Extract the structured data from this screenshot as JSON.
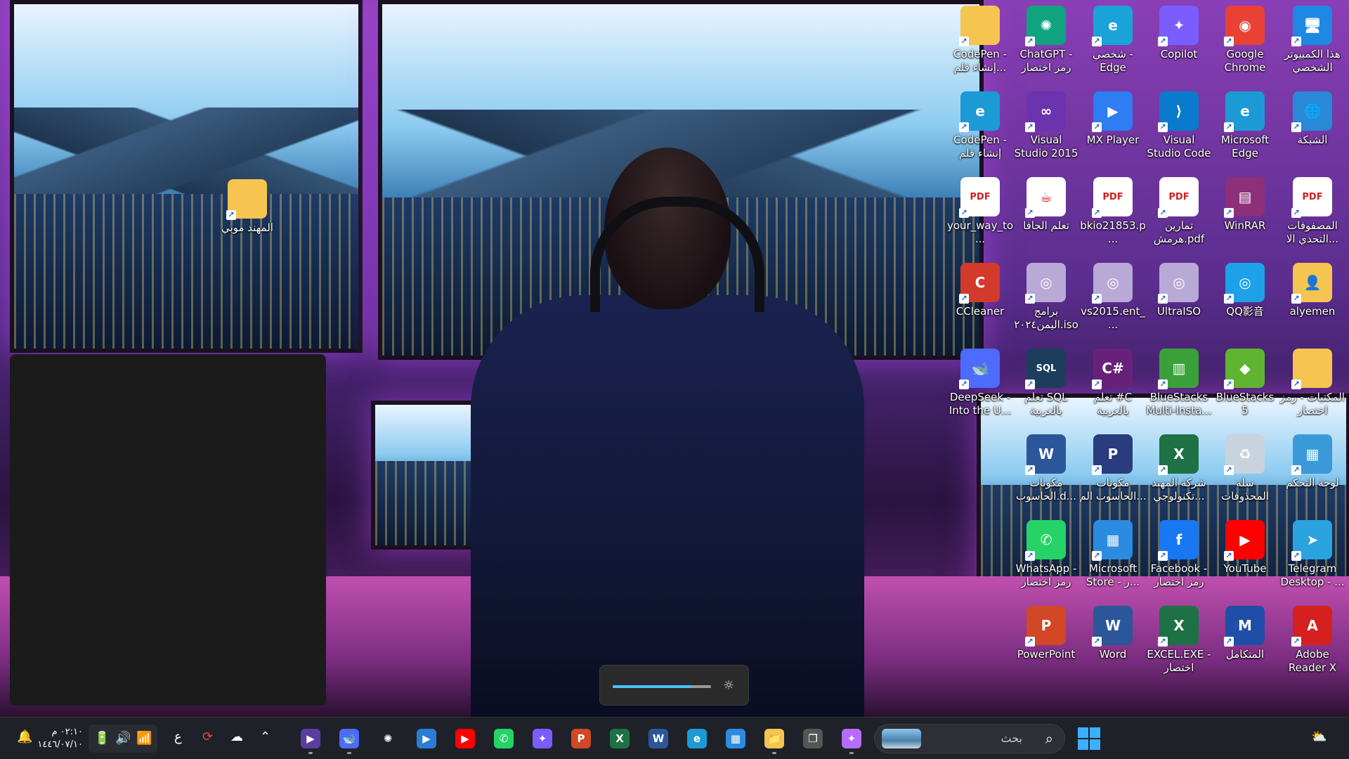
{
  "desktop_icons": [
    {
      "label": "هذا الكمبيوتر الشخصي",
      "icon": "this-pc-icon",
      "color": "#1e88e5",
      "glyph": "🖥"
    },
    {
      "label": "Google Chrome",
      "icon": "chrome-icon",
      "color": "#e94235",
      "glyph": "◉"
    },
    {
      "label": "Copilot",
      "icon": "copilot-icon",
      "color": "#7b5cff",
      "glyph": "✦"
    },
    {
      "label": "شخصي - Edge",
      "icon": "edge-icon",
      "color": "#1aa3d9",
      "glyph": "e"
    },
    {
      "label": "ChatGPT - رمز اختصار",
      "icon": "chatgpt-icon",
      "color": "#10a37f",
      "glyph": "✺"
    },
    {
      "label": "CodePen - إنشاء قلم...",
      "icon": "folder-icon",
      "color": "#f5c451",
      "glyph": ""
    },
    {
      "label": "الشبكة",
      "icon": "network-icon",
      "color": "#2a88d8",
      "glyph": "🌐"
    },
    {
      "label": "Microsoft Edge",
      "icon": "edge-icon",
      "color": "#1c9ad6",
      "glyph": "e"
    },
    {
      "label": "Visual Studio Code",
      "icon": "vscode-icon",
      "color": "#0a7acc",
      "glyph": "⟩"
    },
    {
      "label": "MX Player",
      "icon": "mxplayer-icon",
      "color": "#2f7df3",
      "glyph": "▶"
    },
    {
      "label": "Visual Studio 2015",
      "icon": "visualstudio-icon",
      "color": "#6c33af",
      "glyph": "∞"
    },
    {
      "label": "CodePen - إنشاء قلم",
      "icon": "edge-icon",
      "color": "#1c9ad6",
      "glyph": "e"
    },
    {
      "label": "المصفوفات التحدي الا...",
      "icon": "pdf-icon",
      "color": "#ffffff",
      "glyph": "PDF"
    },
    {
      "label": "WinRAR",
      "icon": "winrar-icon",
      "color": "#8e2f7a",
      "glyph": "▤"
    },
    {
      "label": "تمارين هرمش.pdf",
      "icon": "pdf-icon",
      "color": "#ffffff",
      "glyph": "PDF"
    },
    {
      "label": "bkio21853.p...",
      "icon": "pdf-icon",
      "color": "#ffffff",
      "glyph": "PDF"
    },
    {
      "label": "تعلم الجافا",
      "icon": "java-icon",
      "color": "#ffffff",
      "glyph": "☕"
    },
    {
      "label": "your_way_to...",
      "icon": "pdf-icon",
      "color": "#ffffff",
      "glyph": "PDF"
    },
    {
      "label": "alyemen",
      "icon": "folder-user-icon",
      "color": "#f5c451",
      "glyph": "👤"
    },
    {
      "label": "QQ影音",
      "icon": "qqplayer-icon",
      "color": "#1da1e8",
      "glyph": "◎"
    },
    {
      "label": "UltraISO",
      "icon": "disc-icon",
      "color": "#b8a9d6",
      "glyph": "◎"
    },
    {
      "label": "vs2015.ent_...",
      "icon": "disc-icon",
      "color": "#b8a9d6",
      "glyph": "◎"
    },
    {
      "label": "برامج اليمن٢٠٢٤.iso",
      "icon": "disc-icon",
      "color": "#b8a9d6",
      "glyph": "◎"
    },
    {
      "label": "CCleaner",
      "icon": "ccleaner-icon",
      "color": "#d33a2c",
      "glyph": "C"
    },
    {
      "label": "المكتبات - رمز اختصار",
      "icon": "folder-icon",
      "color": "#f5c451",
      "glyph": ""
    },
    {
      "label": "BlueStacks 5",
      "icon": "bluestacks-icon",
      "color": "#5fb432",
      "glyph": "◆"
    },
    {
      "label": "BlueStacks Multi-Insta...",
      "icon": "bluestacks-multi-icon",
      "color": "#3aa13a",
      "glyph": "▥"
    },
    {
      "label": "تعلم #C بالعربية",
      "icon": "csharp-icon",
      "color": "#68217a",
      "glyph": "C#"
    },
    {
      "label": "تعلم SQL بالعربية",
      "icon": "sql-icon",
      "color": "#1d3d5c",
      "glyph": "SQL"
    },
    {
      "label": "DeepSeek - Into the U...",
      "icon": "deepseek-icon",
      "color": "#4d6bfe",
      "glyph": "🐋"
    },
    {
      "label": "لوحة التحكم",
      "icon": "control-panel-icon",
      "color": "#3a9ad9",
      "glyph": "▦"
    },
    {
      "label": "سلة المحذوفات",
      "icon": "recycle-bin-icon",
      "color": "#c9d3dd",
      "glyph": "♻"
    },
    {
      "label": "شركة المهند تكنولوجي...",
      "icon": "excel-file-icon",
      "color": "#1e7145",
      "glyph": "X"
    },
    {
      "label": "مكونات الحاسوب الم...",
      "icon": "powerpoint-file-icon",
      "color": "#2a3c7e",
      "glyph": "P"
    },
    {
      "label": "مكونات الحاسوب.d...",
      "icon": "word-file-icon",
      "color": "#2b579a",
      "glyph": "W"
    },
    {
      "label": "Telegram Desktop - ...",
      "icon": "telegram-icon",
      "color": "#2aa3df",
      "glyph": "➤"
    },
    {
      "label": "YouTube",
      "icon": "youtube-icon",
      "color": "#ff0000",
      "glyph": "▶"
    },
    {
      "label": "Facebook - رمز اختصار",
      "icon": "facebook-icon",
      "color": "#1877f2",
      "glyph": "f"
    },
    {
      "label": "Microsoft Store - ر...",
      "icon": "store-icon",
      "color": "#2a8be0",
      "glyph": "▦"
    },
    {
      "label": "WhatsApp - رمز اختصار",
      "icon": "whatsapp-icon",
      "color": "#25d366",
      "glyph": "✆"
    },
    {
      "label": "Adobe Reader X",
      "icon": "adobe-reader-icon",
      "color": "#d62020",
      "glyph": "A"
    },
    {
      "label": "المتكامل",
      "icon": "almotakamel-icon",
      "color": "#1f4ea8",
      "glyph": "M"
    },
    {
      "label": "EXCEL.EXE - اختصار",
      "icon": "excel-icon",
      "color": "#1e7145",
      "glyph": "X"
    },
    {
      "label": "Word",
      "icon": "word-icon",
      "color": "#2b579a",
      "glyph": "W"
    },
    {
      "label": "PowerPoint",
      "icon": "powerpoint-icon",
      "color": "#d24726",
      "glyph": "P"
    },
    {
      "label": "المهند موبي",
      "icon": "folder-icon",
      "color": "#f5c451",
      "glyph": ""
    }
  ],
  "brightness": {
    "level_percent": 80
  },
  "taskbar": {
    "clock_time": "٠٢:١٠ م",
    "clock_date": "١٤٤٦/٠٧/١٠",
    "language": "ع",
    "search_placeholder": "بحث",
    "apps": [
      {
        "name": "media-player",
        "glyph": "▶",
        "color": "#5a3da0"
      },
      {
        "name": "deepseek",
        "glyph": "🐋",
        "color": "#4d6bfe"
      },
      {
        "name": "chatgpt",
        "glyph": "✺",
        "color": "#1f2128"
      },
      {
        "name": "movies",
        "glyph": "▶",
        "color": "#2a7cd4"
      },
      {
        "name": "youtube",
        "glyph": "▶",
        "color": "#ff0000"
      },
      {
        "name": "whatsapp",
        "glyph": "✆",
        "color": "#25d366"
      },
      {
        "name": "copilot",
        "glyph": "✦",
        "color": "#7b5cff"
      },
      {
        "name": "powerpoint",
        "glyph": "P",
        "color": "#d24726"
      },
      {
        "name": "excel",
        "glyph": "X",
        "color": "#1e7145"
      },
      {
        "name": "word",
        "glyph": "W",
        "color": "#2b579a"
      },
      {
        "name": "edge",
        "glyph": "e",
        "color": "#1c9ad6"
      },
      {
        "name": "store",
        "glyph": "▦",
        "color": "#2a8be0"
      },
      {
        "name": "file-explorer",
        "glyph": "📁",
        "color": "#f5c451"
      },
      {
        "name": "task-view",
        "glyph": "❐",
        "color": "#555"
      },
      {
        "name": "copilot-pre",
        "glyph": "✦",
        "color": "#b56cff"
      }
    ]
  }
}
